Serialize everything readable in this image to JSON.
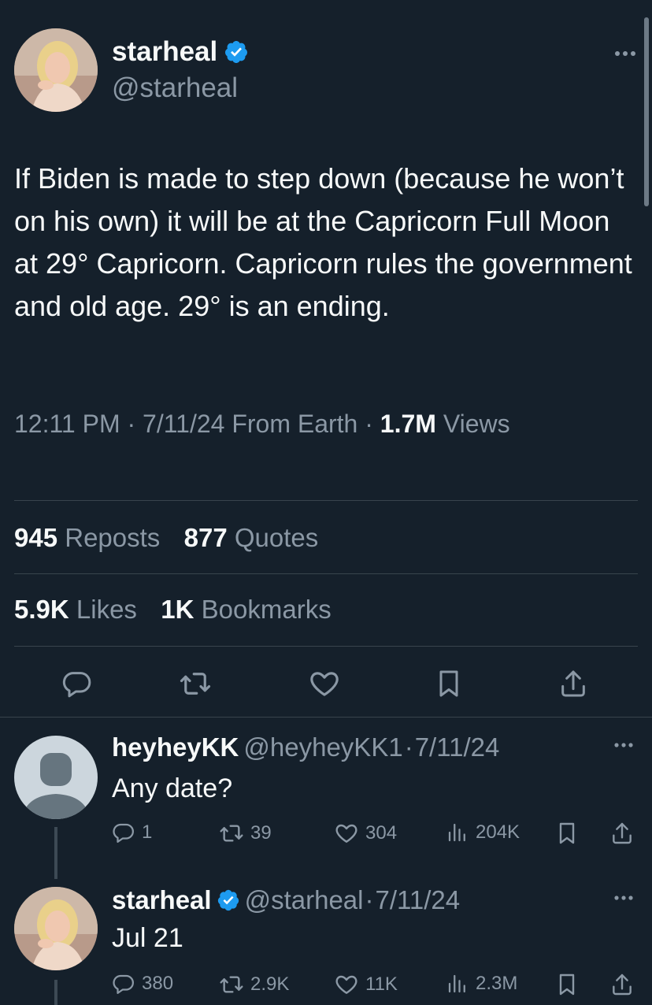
{
  "main_tweet": {
    "display_name": "starheal",
    "handle": "@starheal",
    "verified_icon": "verified-badge-icon",
    "text": "If Biden is made to step down (because he won’t on his own) it will be at the Capricorn Full Moon at 29° Capricorn. Capricorn rules the government and old age. 29° is an ending.",
    "time": "12:11 PM",
    "date": "7/11/24",
    "source": "From Earth",
    "views_count": "1.7M",
    "views_label": "Views",
    "reposts_count": "945",
    "reposts_label": "Reposts",
    "quotes_count": "877",
    "quotes_label": "Quotes",
    "likes_count": "5.9K",
    "likes_label": "Likes",
    "bookmarks_count": "1K",
    "bookmarks_label": "Bookmarks"
  },
  "replies": [
    {
      "display_name": "heyheyKK",
      "handle": "@heyheyKK1",
      "separator": "·",
      "date": "7/11/24",
      "text": "Any date?",
      "replies": "1",
      "reposts": "39",
      "likes": "304",
      "views": "204K"
    },
    {
      "display_name": "starheal",
      "handle": "@starheal",
      "separator": "·",
      "date": "7/11/24",
      "text": "Jul 21",
      "replies": "380",
      "reposts": "2.9K",
      "likes": "11K",
      "views": "2.3M"
    }
  ],
  "colors": {
    "background": "#15202b",
    "text": "#f7f9f9",
    "muted": "#8b98a5",
    "verified": "#1d9bf0",
    "divider": "#38444d"
  }
}
